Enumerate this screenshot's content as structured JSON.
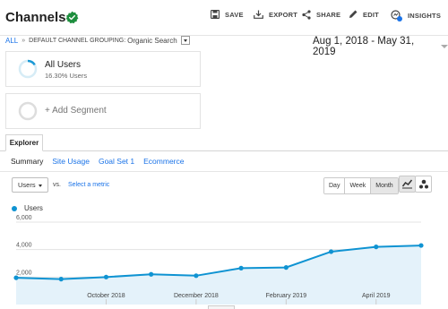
{
  "header": {
    "title": "Channels",
    "actions": [
      {
        "label": "SAVE",
        "icon": "save-icon"
      },
      {
        "label": "EXPORT",
        "icon": "export-icon"
      },
      {
        "label": "SHARE",
        "icon": "share-icon"
      },
      {
        "label": "EDIT",
        "icon": "edit-icon"
      },
      {
        "label": "INSIGHTS",
        "icon": "insights-icon"
      }
    ]
  },
  "breadcrumb": {
    "all": "ALL",
    "separator": "»",
    "grouping_label": "DEFAULT CHANNEL GROUPING:",
    "grouping_value": "Organic Search"
  },
  "date_range": "Aug 1, 2018 - May 31, 2019",
  "segments": {
    "active": {
      "name": "All Users",
      "share_text": "16.30% Users",
      "share_fraction": 0.163
    },
    "add_label": "+ Add Segment"
  },
  "tabs": {
    "explorer": "Explorer",
    "subtabs": [
      "Summary",
      "Site Usage",
      "Goal Set 1",
      "Ecommerce"
    ]
  },
  "controls": {
    "metric": "Users",
    "vs": "vs.",
    "select_metric": "Select a metric",
    "periods": [
      "Day",
      "Week",
      "Month"
    ],
    "active_period": "Month"
  },
  "colors": {
    "accent": "#1a73e8",
    "series": "#0f93d2",
    "fill": "#e4f2fa",
    "verified": "#1e8e3e"
  },
  "chart_data": {
    "type": "area",
    "series": [
      {
        "name": "Users",
        "x": [
          "Aug 2018",
          "Sep 2018",
          "Oct 2018",
          "Nov 2018",
          "Dec 2018",
          "Jan 2019",
          "Feb 2019",
          "Mar 2019",
          "Apr 2019",
          "May 2019"
        ],
        "values": [
          1950,
          1850,
          2000,
          2200,
          2100,
          2650,
          2700,
          3850,
          4200,
          4300
        ]
      }
    ],
    "yticks": [
      "6,000",
      "4,000",
      "2,000"
    ],
    "ylim": [
      0,
      6000
    ],
    "xticks": [
      {
        "label": "October 2018",
        "index": 2
      },
      {
        "label": "December 2018",
        "index": 4
      },
      {
        "label": "February 2019",
        "index": 6
      },
      {
        "label": "April 2019",
        "index": 8
      }
    ],
    "grid": true,
    "legend_placement": "top-left"
  }
}
